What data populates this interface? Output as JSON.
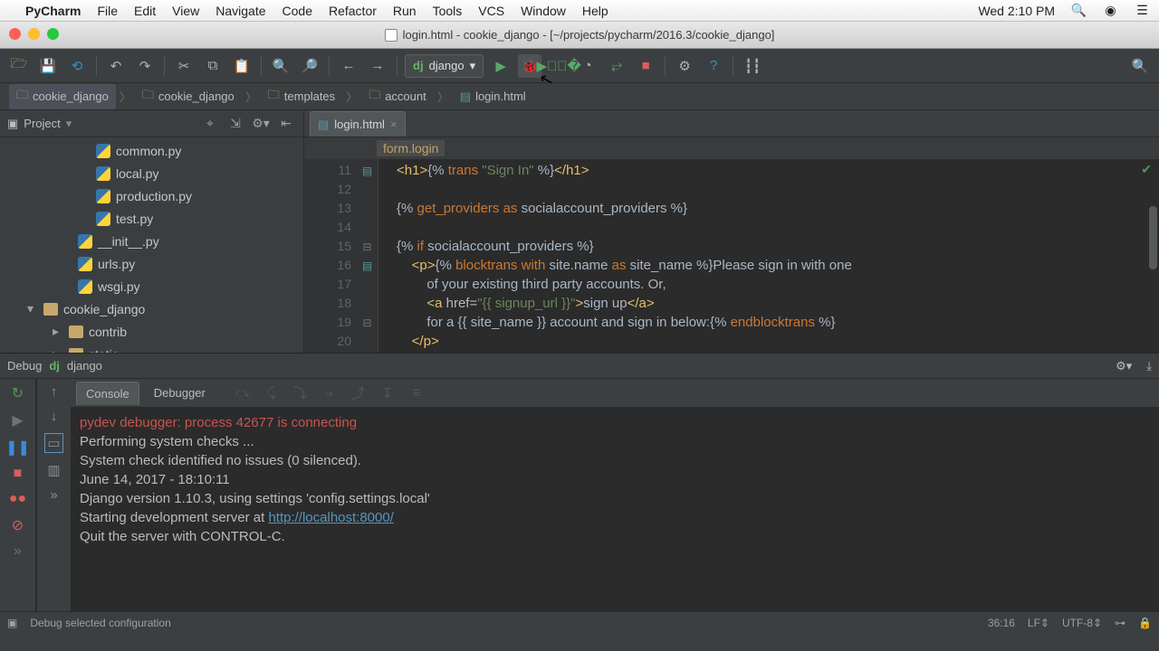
{
  "mac": {
    "app": "PyCharm",
    "menus": [
      "File",
      "Edit",
      "View",
      "Navigate",
      "Code",
      "Refactor",
      "Run",
      "Tools",
      "VCS",
      "Window",
      "Help"
    ],
    "clock": "Wed 2:10 PM"
  },
  "window": {
    "title": "login.html - cookie_django - [~/projects/pycharm/2016.3/cookie_django]"
  },
  "toolbar": {
    "run_config": "django"
  },
  "breadcrumbs": [
    "cookie_django",
    "cookie_django",
    "templates",
    "account",
    "login.html"
  ],
  "project": {
    "label": "Project",
    "items": [
      {
        "type": "py",
        "level": 2,
        "name": "common.py"
      },
      {
        "type": "py",
        "level": 2,
        "name": "local.py"
      },
      {
        "type": "py",
        "level": 2,
        "name": "production.py"
      },
      {
        "type": "py",
        "level": 2,
        "name": "test.py"
      },
      {
        "type": "py",
        "level": 1,
        "name": "__init__.py"
      },
      {
        "type": "py",
        "level": 1,
        "name": "urls.py"
      },
      {
        "type": "py",
        "level": 1,
        "name": "wsgi.py"
      },
      {
        "type": "dir",
        "level": 0,
        "name": "cookie_django",
        "arrow": "▾"
      },
      {
        "type": "dir",
        "level": 0,
        "name": "contrib",
        "arrow": "▸",
        "indent": 1
      },
      {
        "type": "dir",
        "level": 0,
        "name": "static",
        "arrow": "▸",
        "indent": 1
      }
    ]
  },
  "editor": {
    "tab": "login.html",
    "context": "form.login",
    "first_line_no": 11,
    "lines": [
      {
        "n": 11,
        "html": "<span class='tag'>&lt;h1&gt;</span>{% <span class='kw'>trans</span> <span class='str'>\"Sign In\"</span> %}<span class='tag'>&lt;/h1&gt;</span>"
      },
      {
        "n": 12,
        "html": ""
      },
      {
        "n": 13,
        "html": "{% <span class='kw'>get_providers</span> <span class='kw'>as</span> socialaccount_providers %}"
      },
      {
        "n": 14,
        "html": ""
      },
      {
        "n": 15,
        "html": "{% <span class='kw'>if</span> socialaccount_providers %}"
      },
      {
        "n": 16,
        "html": "    <span class='tag'>&lt;p&gt;</span>{% <span class='kw'>blocktrans</span> <span class='kw'>with</span> site.name <span class='kw'>as</span> site_name %}Please sign in with one"
      },
      {
        "n": 17,
        "html": "        of your existing third party accounts. Or,"
      },
      {
        "n": 18,
        "html": "        <span class='tag'>&lt;a </span><span class='attr'>href=</span><span class='val'>\"{{ signup_url }}\"</span><span class='tag'>&gt;</span>sign up<span class='tag'>&lt;/a&gt;</span>"
      },
      {
        "n": 19,
        "html": "        for a {{ site_name }} account and sign in below:{% <span class='kw'>endblocktrans</span> %}"
      },
      {
        "n": 20,
        "html": "    <span class='tag'>&lt;/p&gt;</span>"
      }
    ]
  },
  "debug": {
    "header_label": "Debug",
    "header_config": "django",
    "tabs": {
      "console": "Console",
      "debugger": "Debugger"
    },
    "console_lines": [
      {
        "cls": "warn",
        "text": "pydev debugger: process 42677 is connecting"
      },
      {
        "cls": "",
        "text": ""
      },
      {
        "cls": "",
        "text": "Performing system checks ..."
      },
      {
        "cls": "",
        "text": ""
      },
      {
        "cls": "",
        "text": "System check identified no issues (0 silenced)."
      },
      {
        "cls": "",
        "text": "June 14, 2017 - 18:10:11"
      },
      {
        "cls": "",
        "text": "Django version 1.10.3, using settings 'config.settings.local'"
      },
      {
        "cls": "",
        "text": "Starting development server at ",
        "link": "http://localhost:8000/"
      },
      {
        "cls": "",
        "text": "Quit the server with CONTROL-C."
      }
    ]
  },
  "status": {
    "hint": "Debug selected configuration",
    "pos": "36:16",
    "eol": "LF⇕",
    "enc": "UTF-8⇕",
    "ctx": "⊶",
    "lock": "🔒"
  }
}
